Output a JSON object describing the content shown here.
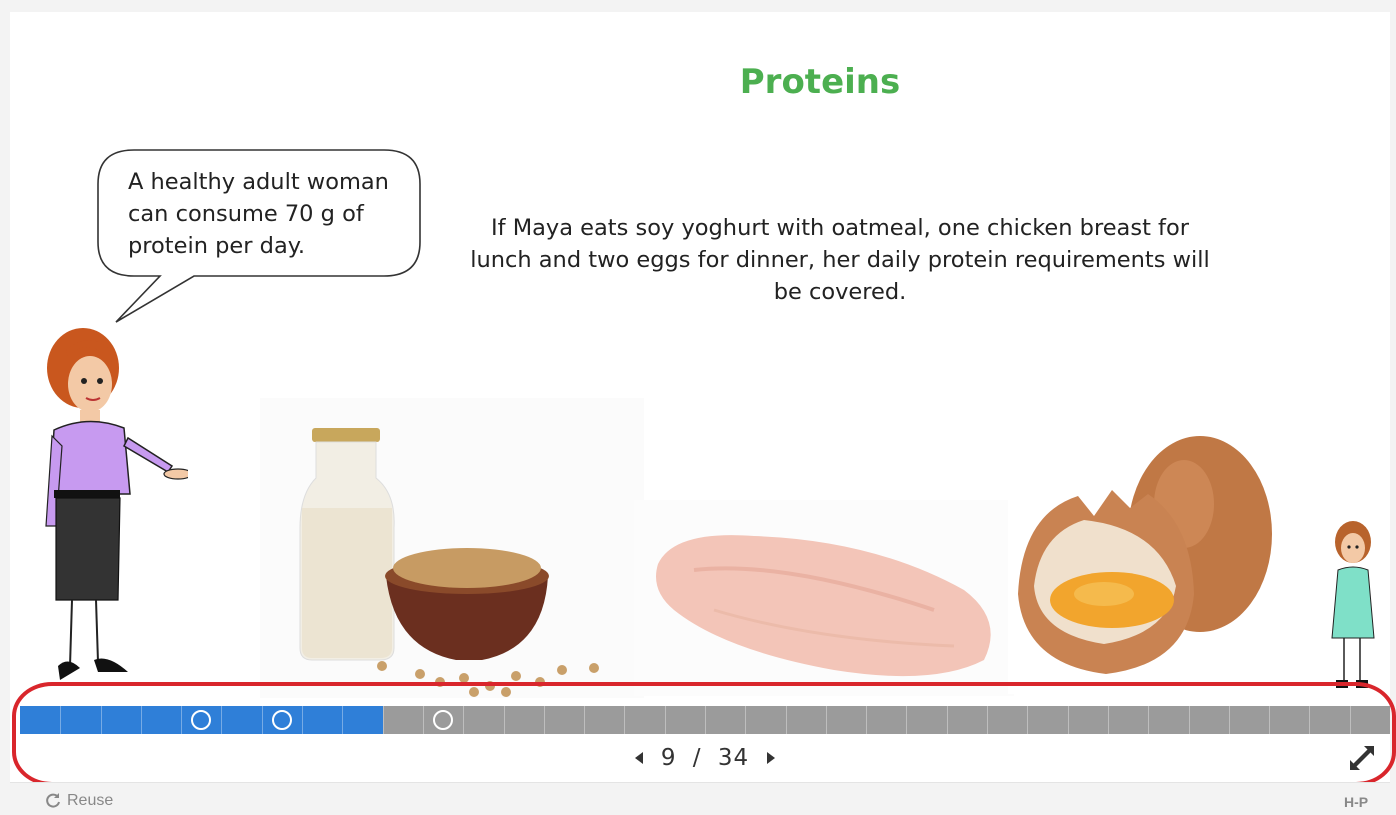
{
  "slide": {
    "title": "Proteins",
    "body": "If Maya eats soy yoghurt with oatmeal, one chicken breast for lunch and two eggs for dinner, her daily protein requirements will be covered.",
    "speech_bubble": "A healthy adult woman can consume 70 g of protein per day."
  },
  "characters": {
    "narrator_icon": "woman-cartoon-icon",
    "maya_icon": "girl-cartoon-icon"
  },
  "images": {
    "left": "soy-milk-and-soybeans-photo",
    "center": "raw-chicken-breast-photo",
    "right": "eggs-photo"
  },
  "navigation": {
    "current": "9",
    "separator": "/",
    "total": "34",
    "prev_icon": "caret-left-icon",
    "next_icon": "caret-right-icon",
    "fullscreen_icon": "fullscreen-icon",
    "progress_slides_done": 9,
    "progress_slides_total": 34,
    "answered_markers_at_slides": [
      5,
      7,
      11
    ]
  },
  "footer": {
    "reuse_label": "Reuse",
    "brand": "H-P"
  },
  "colors": {
    "title": "#4caf50",
    "progress_fill": "#2f7fd8",
    "progress_track": "#9b9b9b",
    "highlight": "#d9262c"
  }
}
